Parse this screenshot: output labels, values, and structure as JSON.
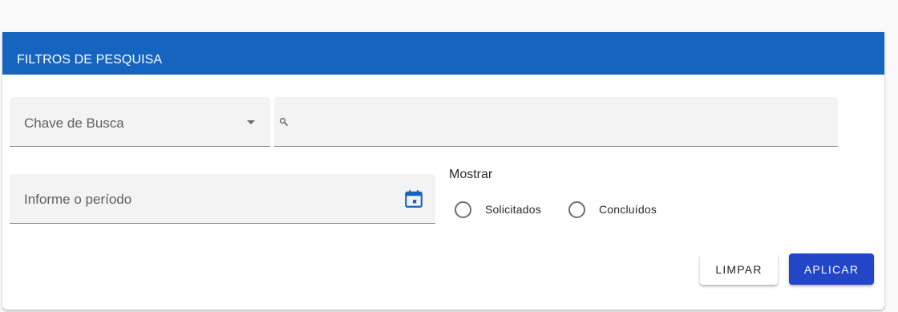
{
  "panel": {
    "title": "FILTROS DE PESQUISA"
  },
  "search": {
    "key_select_label": "Chave de Busca",
    "query_value": ""
  },
  "period": {
    "label": "Informe o período"
  },
  "show": {
    "label": "Mostrar",
    "options": [
      {
        "label": "Solicitados",
        "selected": false
      },
      {
        "label": "Concluídos",
        "selected": false
      }
    ]
  },
  "actions": {
    "clear_label": "LIMPAR",
    "apply_label": "APLICAR"
  },
  "colors": {
    "header": "#1565c0",
    "primary_button": "#2346c8",
    "calendar_icon": "#1565c0"
  },
  "icons": {
    "select": "chevron-down-icon",
    "search": "search-icon",
    "period": "calendar-icon"
  }
}
